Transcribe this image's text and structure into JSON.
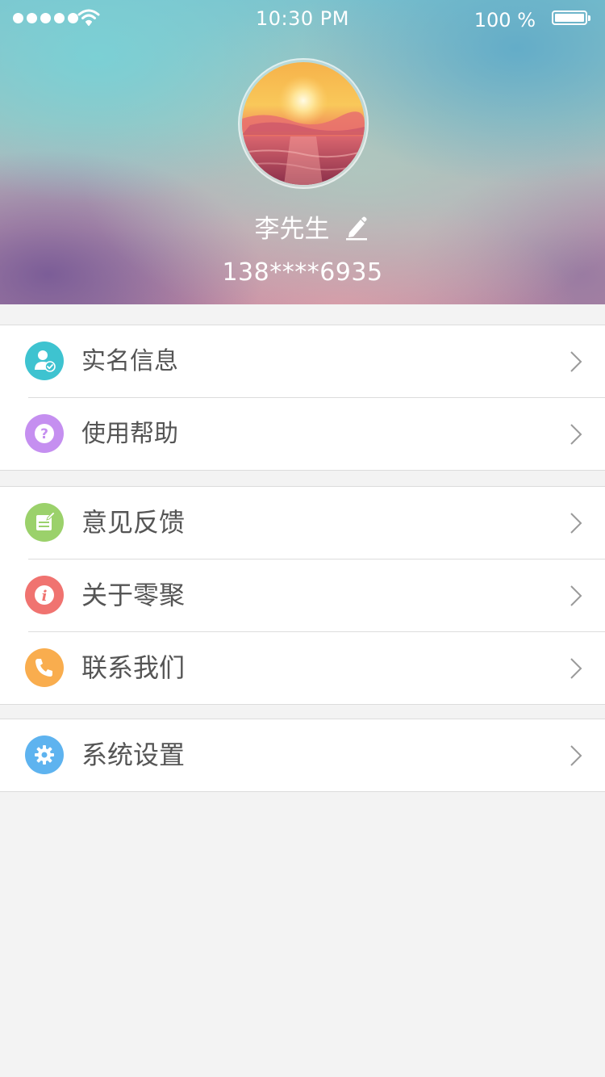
{
  "status_bar": {
    "time": "10:30 PM",
    "battery_text": "100 %"
  },
  "profile": {
    "name": "李先生",
    "phone": "138****6935"
  },
  "menu_groups": [
    {
      "items": [
        {
          "label": "实名信息",
          "icon": "user-verified-icon",
          "color": "#3ec3d0"
        },
        {
          "label": "使用帮助",
          "icon": "help-icon",
          "color": "#c58ff0"
        }
      ]
    },
    {
      "items": [
        {
          "label": "意见反馈",
          "icon": "feedback-icon",
          "color": "#9bd16b"
        },
        {
          "label": "关于零聚",
          "icon": "info-icon",
          "color": "#f07370"
        },
        {
          "label": "联系我们",
          "icon": "phone-icon",
          "color": "#f9ad4e"
        }
      ]
    },
    {
      "items": [
        {
          "label": "系统设置",
          "icon": "gear-icon",
          "color": "#5eb3ef"
        }
      ]
    }
  ],
  "colors": {
    "background": "#f3f3f3",
    "divider": "#dcdcdc",
    "label_text": "#555555"
  }
}
